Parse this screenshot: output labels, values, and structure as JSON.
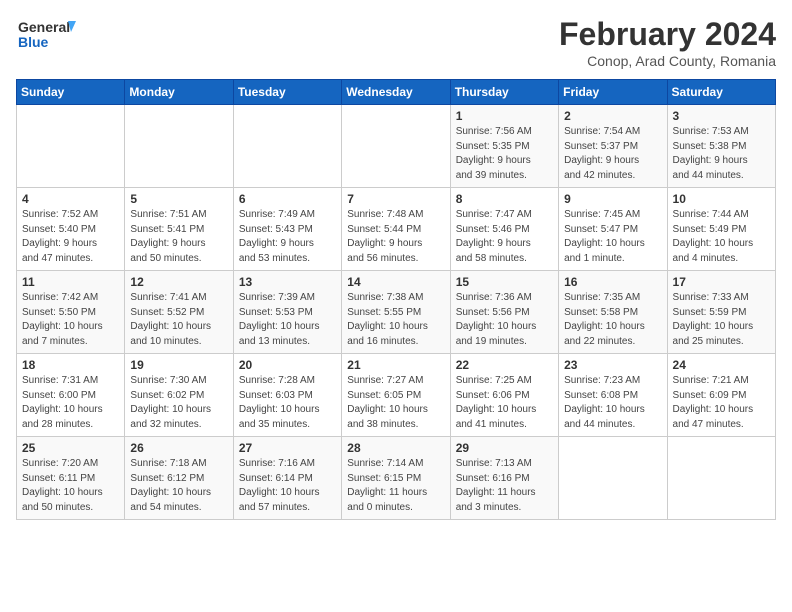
{
  "header": {
    "logo_line1": "General",
    "logo_line2": "Blue",
    "title": "February 2024",
    "subtitle": "Conop, Arad County, Romania"
  },
  "weekdays": [
    "Sunday",
    "Monday",
    "Tuesday",
    "Wednesday",
    "Thursday",
    "Friday",
    "Saturday"
  ],
  "weeks": [
    [
      {
        "day": "",
        "info": ""
      },
      {
        "day": "",
        "info": ""
      },
      {
        "day": "",
        "info": ""
      },
      {
        "day": "",
        "info": ""
      },
      {
        "day": "1",
        "info": "Sunrise: 7:56 AM\nSunset: 5:35 PM\nDaylight: 9 hours\nand 39 minutes."
      },
      {
        "day": "2",
        "info": "Sunrise: 7:54 AM\nSunset: 5:37 PM\nDaylight: 9 hours\nand 42 minutes."
      },
      {
        "day": "3",
        "info": "Sunrise: 7:53 AM\nSunset: 5:38 PM\nDaylight: 9 hours\nand 44 minutes."
      }
    ],
    [
      {
        "day": "4",
        "info": "Sunrise: 7:52 AM\nSunset: 5:40 PM\nDaylight: 9 hours\nand 47 minutes."
      },
      {
        "day": "5",
        "info": "Sunrise: 7:51 AM\nSunset: 5:41 PM\nDaylight: 9 hours\nand 50 minutes."
      },
      {
        "day": "6",
        "info": "Sunrise: 7:49 AM\nSunset: 5:43 PM\nDaylight: 9 hours\nand 53 minutes."
      },
      {
        "day": "7",
        "info": "Sunrise: 7:48 AM\nSunset: 5:44 PM\nDaylight: 9 hours\nand 56 minutes."
      },
      {
        "day": "8",
        "info": "Sunrise: 7:47 AM\nSunset: 5:46 PM\nDaylight: 9 hours\nand 58 minutes."
      },
      {
        "day": "9",
        "info": "Sunrise: 7:45 AM\nSunset: 5:47 PM\nDaylight: 10 hours\nand 1 minute."
      },
      {
        "day": "10",
        "info": "Sunrise: 7:44 AM\nSunset: 5:49 PM\nDaylight: 10 hours\nand 4 minutes."
      }
    ],
    [
      {
        "day": "11",
        "info": "Sunrise: 7:42 AM\nSunset: 5:50 PM\nDaylight: 10 hours\nand 7 minutes."
      },
      {
        "day": "12",
        "info": "Sunrise: 7:41 AM\nSunset: 5:52 PM\nDaylight: 10 hours\nand 10 minutes."
      },
      {
        "day": "13",
        "info": "Sunrise: 7:39 AM\nSunset: 5:53 PM\nDaylight: 10 hours\nand 13 minutes."
      },
      {
        "day": "14",
        "info": "Sunrise: 7:38 AM\nSunset: 5:55 PM\nDaylight: 10 hours\nand 16 minutes."
      },
      {
        "day": "15",
        "info": "Sunrise: 7:36 AM\nSunset: 5:56 PM\nDaylight: 10 hours\nand 19 minutes."
      },
      {
        "day": "16",
        "info": "Sunrise: 7:35 AM\nSunset: 5:58 PM\nDaylight: 10 hours\nand 22 minutes."
      },
      {
        "day": "17",
        "info": "Sunrise: 7:33 AM\nSunset: 5:59 PM\nDaylight: 10 hours\nand 25 minutes."
      }
    ],
    [
      {
        "day": "18",
        "info": "Sunrise: 7:31 AM\nSunset: 6:00 PM\nDaylight: 10 hours\nand 28 minutes."
      },
      {
        "day": "19",
        "info": "Sunrise: 7:30 AM\nSunset: 6:02 PM\nDaylight: 10 hours\nand 32 minutes."
      },
      {
        "day": "20",
        "info": "Sunrise: 7:28 AM\nSunset: 6:03 PM\nDaylight: 10 hours\nand 35 minutes."
      },
      {
        "day": "21",
        "info": "Sunrise: 7:27 AM\nSunset: 6:05 PM\nDaylight: 10 hours\nand 38 minutes."
      },
      {
        "day": "22",
        "info": "Sunrise: 7:25 AM\nSunset: 6:06 PM\nDaylight: 10 hours\nand 41 minutes."
      },
      {
        "day": "23",
        "info": "Sunrise: 7:23 AM\nSunset: 6:08 PM\nDaylight: 10 hours\nand 44 minutes."
      },
      {
        "day": "24",
        "info": "Sunrise: 7:21 AM\nSunset: 6:09 PM\nDaylight: 10 hours\nand 47 minutes."
      }
    ],
    [
      {
        "day": "25",
        "info": "Sunrise: 7:20 AM\nSunset: 6:11 PM\nDaylight: 10 hours\nand 50 minutes."
      },
      {
        "day": "26",
        "info": "Sunrise: 7:18 AM\nSunset: 6:12 PM\nDaylight: 10 hours\nand 54 minutes."
      },
      {
        "day": "27",
        "info": "Sunrise: 7:16 AM\nSunset: 6:14 PM\nDaylight: 10 hours\nand 57 minutes."
      },
      {
        "day": "28",
        "info": "Sunrise: 7:14 AM\nSunset: 6:15 PM\nDaylight: 11 hours\nand 0 minutes."
      },
      {
        "day": "29",
        "info": "Sunrise: 7:13 AM\nSunset: 6:16 PM\nDaylight: 11 hours\nand 3 minutes."
      },
      {
        "day": "",
        "info": ""
      },
      {
        "day": "",
        "info": ""
      }
    ]
  ]
}
